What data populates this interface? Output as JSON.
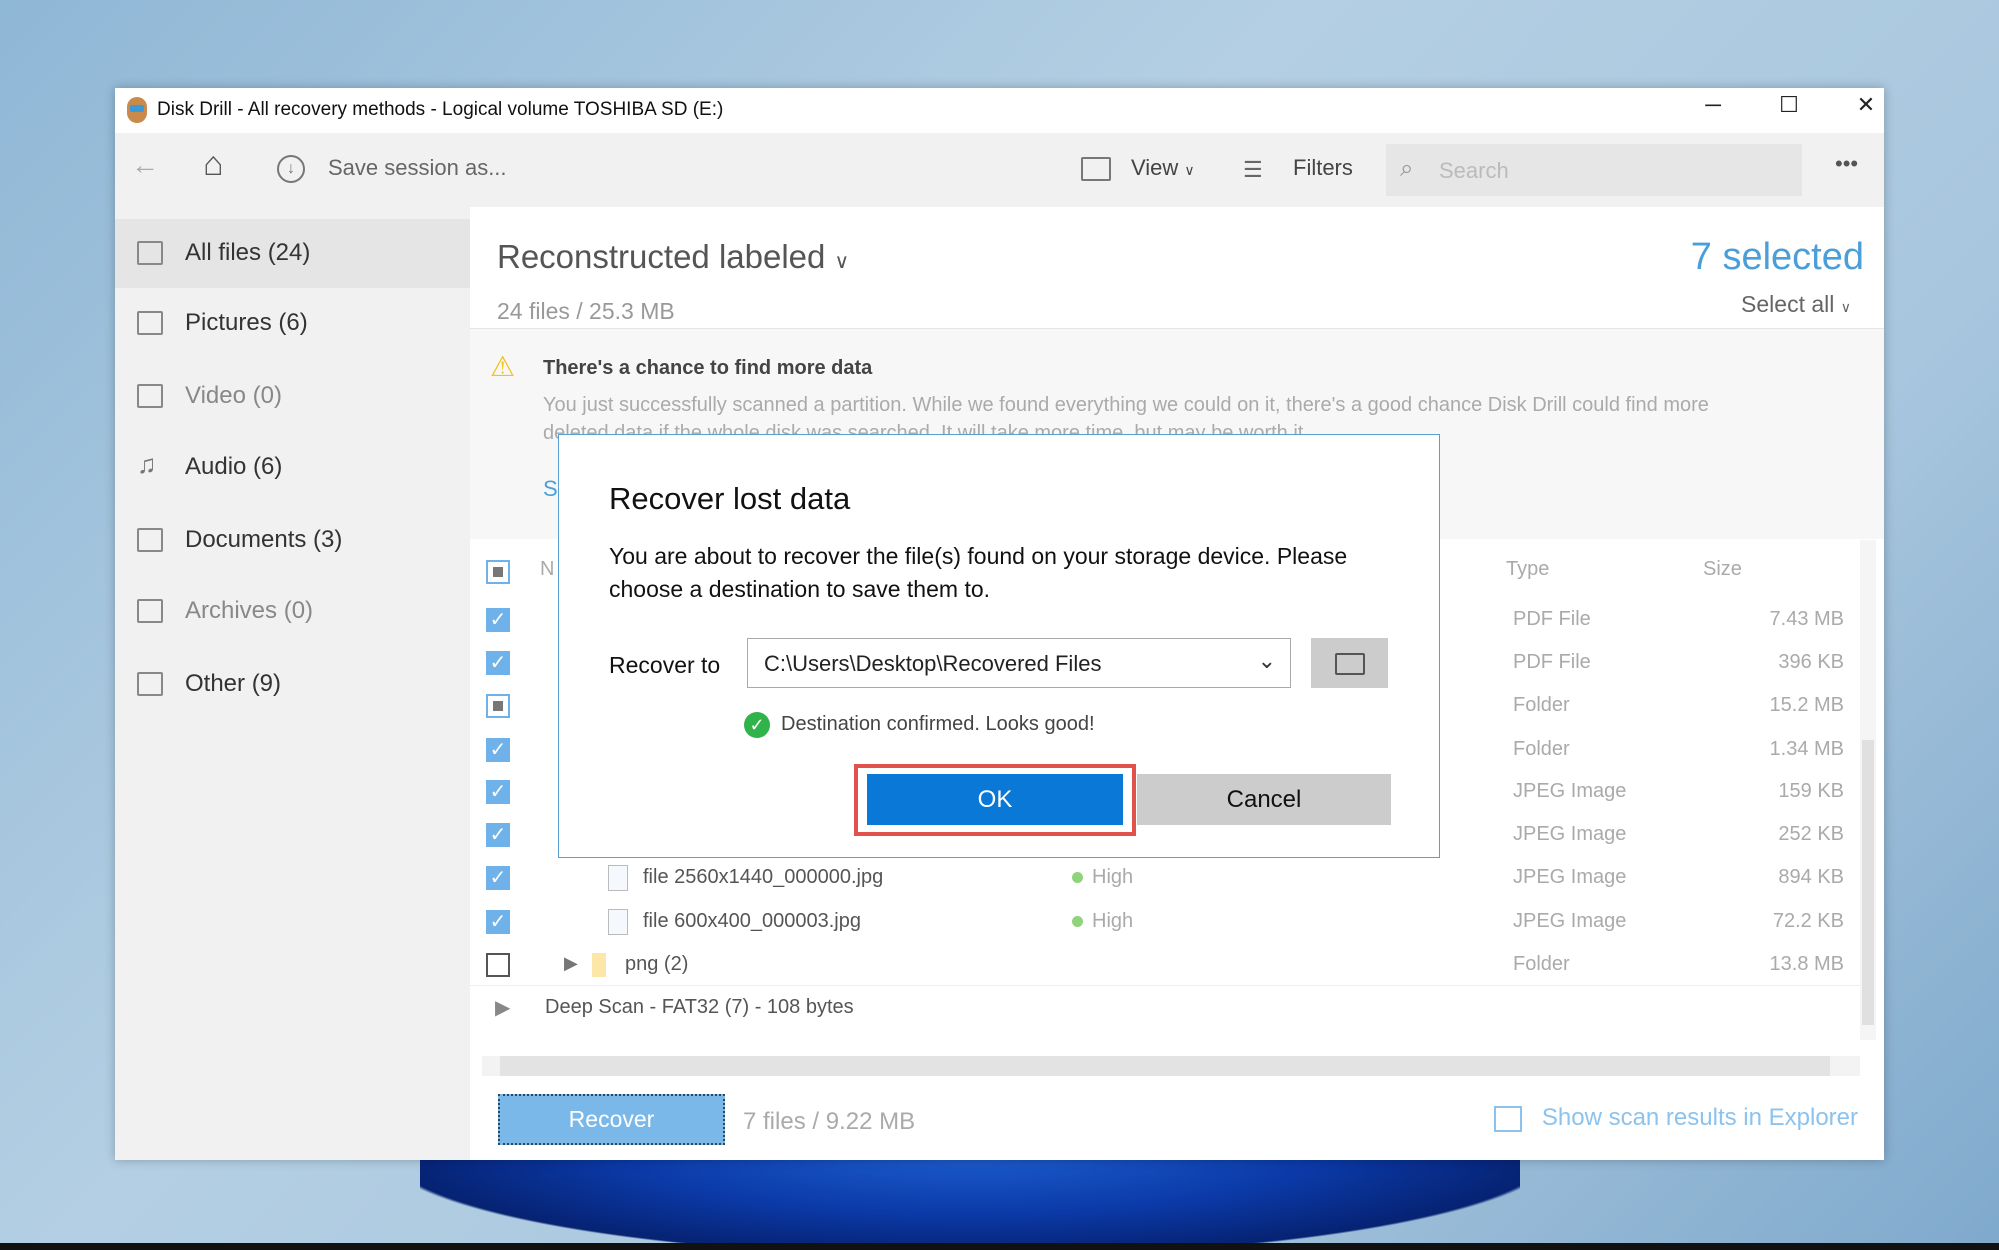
{
  "window": {
    "title": "Disk Drill - All recovery methods - Logical volume TOSHIBA SD (E:)",
    "minimize": "─",
    "maximize": "☐",
    "close": "✕"
  },
  "toolbar": {
    "back": "←",
    "home": "⌂",
    "save_session": "Save session as...",
    "view": "View",
    "filters": "Filters",
    "search_placeholder": "Search",
    "more": "•••"
  },
  "sidebar": {
    "items": [
      {
        "label": "All files (24)",
        "active": true
      },
      {
        "label": "Pictures (6)"
      },
      {
        "label": "Video (0)",
        "dim": true
      },
      {
        "label": "Audio (6)"
      },
      {
        "label": "Documents (3)"
      },
      {
        "label": "Archives (0)",
        "dim": true
      },
      {
        "label": "Other (9)"
      }
    ]
  },
  "header": {
    "title": "Reconstructed labeled",
    "summary": "24 files / 25.3 MB",
    "selected": "7 selected",
    "select_all": "Select all"
  },
  "warning": {
    "title": "There's a chance to find more data",
    "body": "You just successfully scanned a partition. While we found everything we could on it, there's a good chance Disk Drill could find more",
    "body2": "deleted data if the whole disk was searched. It will take more time, but may be worth it.",
    "link": "S"
  },
  "table": {
    "columns": {
      "name": "N",
      "type": "Type",
      "size": "Size"
    },
    "rows": [
      {
        "checked": "on",
        "name": "",
        "type": "PDF File",
        "size": "7.43 MB"
      },
      {
        "checked": "on",
        "name": "",
        "type": "PDF File",
        "size": "396 KB"
      },
      {
        "checked": "part",
        "name": "",
        "type": "Folder",
        "size": "15.2 MB"
      },
      {
        "checked": "on",
        "name": "",
        "type": "Folder",
        "size": "1.34 MB"
      },
      {
        "checked": "on",
        "name": "",
        "type": "JPEG Image",
        "size": "159 KB"
      },
      {
        "checked": "on",
        "name": "",
        "type": "JPEG Image",
        "size": "252 KB"
      },
      {
        "checked": "on",
        "name": "file 2560x1440_000000.jpg",
        "chance": "High",
        "type": "JPEG Image",
        "size": "894 KB"
      },
      {
        "checked": "on",
        "name": "file 600x400_000003.jpg",
        "chance": "High",
        "type": "JPEG Image",
        "size": "72.2 KB"
      },
      {
        "checked": "off",
        "name": "png (2)",
        "type": "Folder",
        "size": "13.8 MB"
      }
    ],
    "deep_scan": "Deep Scan - FAT32 (7) - 108 bytes"
  },
  "footer": {
    "recover": "Recover",
    "summary": "7 files / 9.22 MB",
    "explorer_link": "Show scan results in Explorer"
  },
  "dialog": {
    "title": "Recover lost data",
    "body1": "You are about to recover the file(s) found on your storage device. Please",
    "body2": "choose a destination to save them to.",
    "recover_to_label": "Recover to",
    "path": "C:\\Users\\Desktop\\Recovered Files",
    "status": "Destination confirmed. Looks good!",
    "ok": "OK",
    "cancel": "Cancel"
  },
  "colors": {
    "accent": "#0a78d7",
    "highlight": "#e0524a",
    "link": "#4a9fd8",
    "success": "#2fb34a"
  }
}
